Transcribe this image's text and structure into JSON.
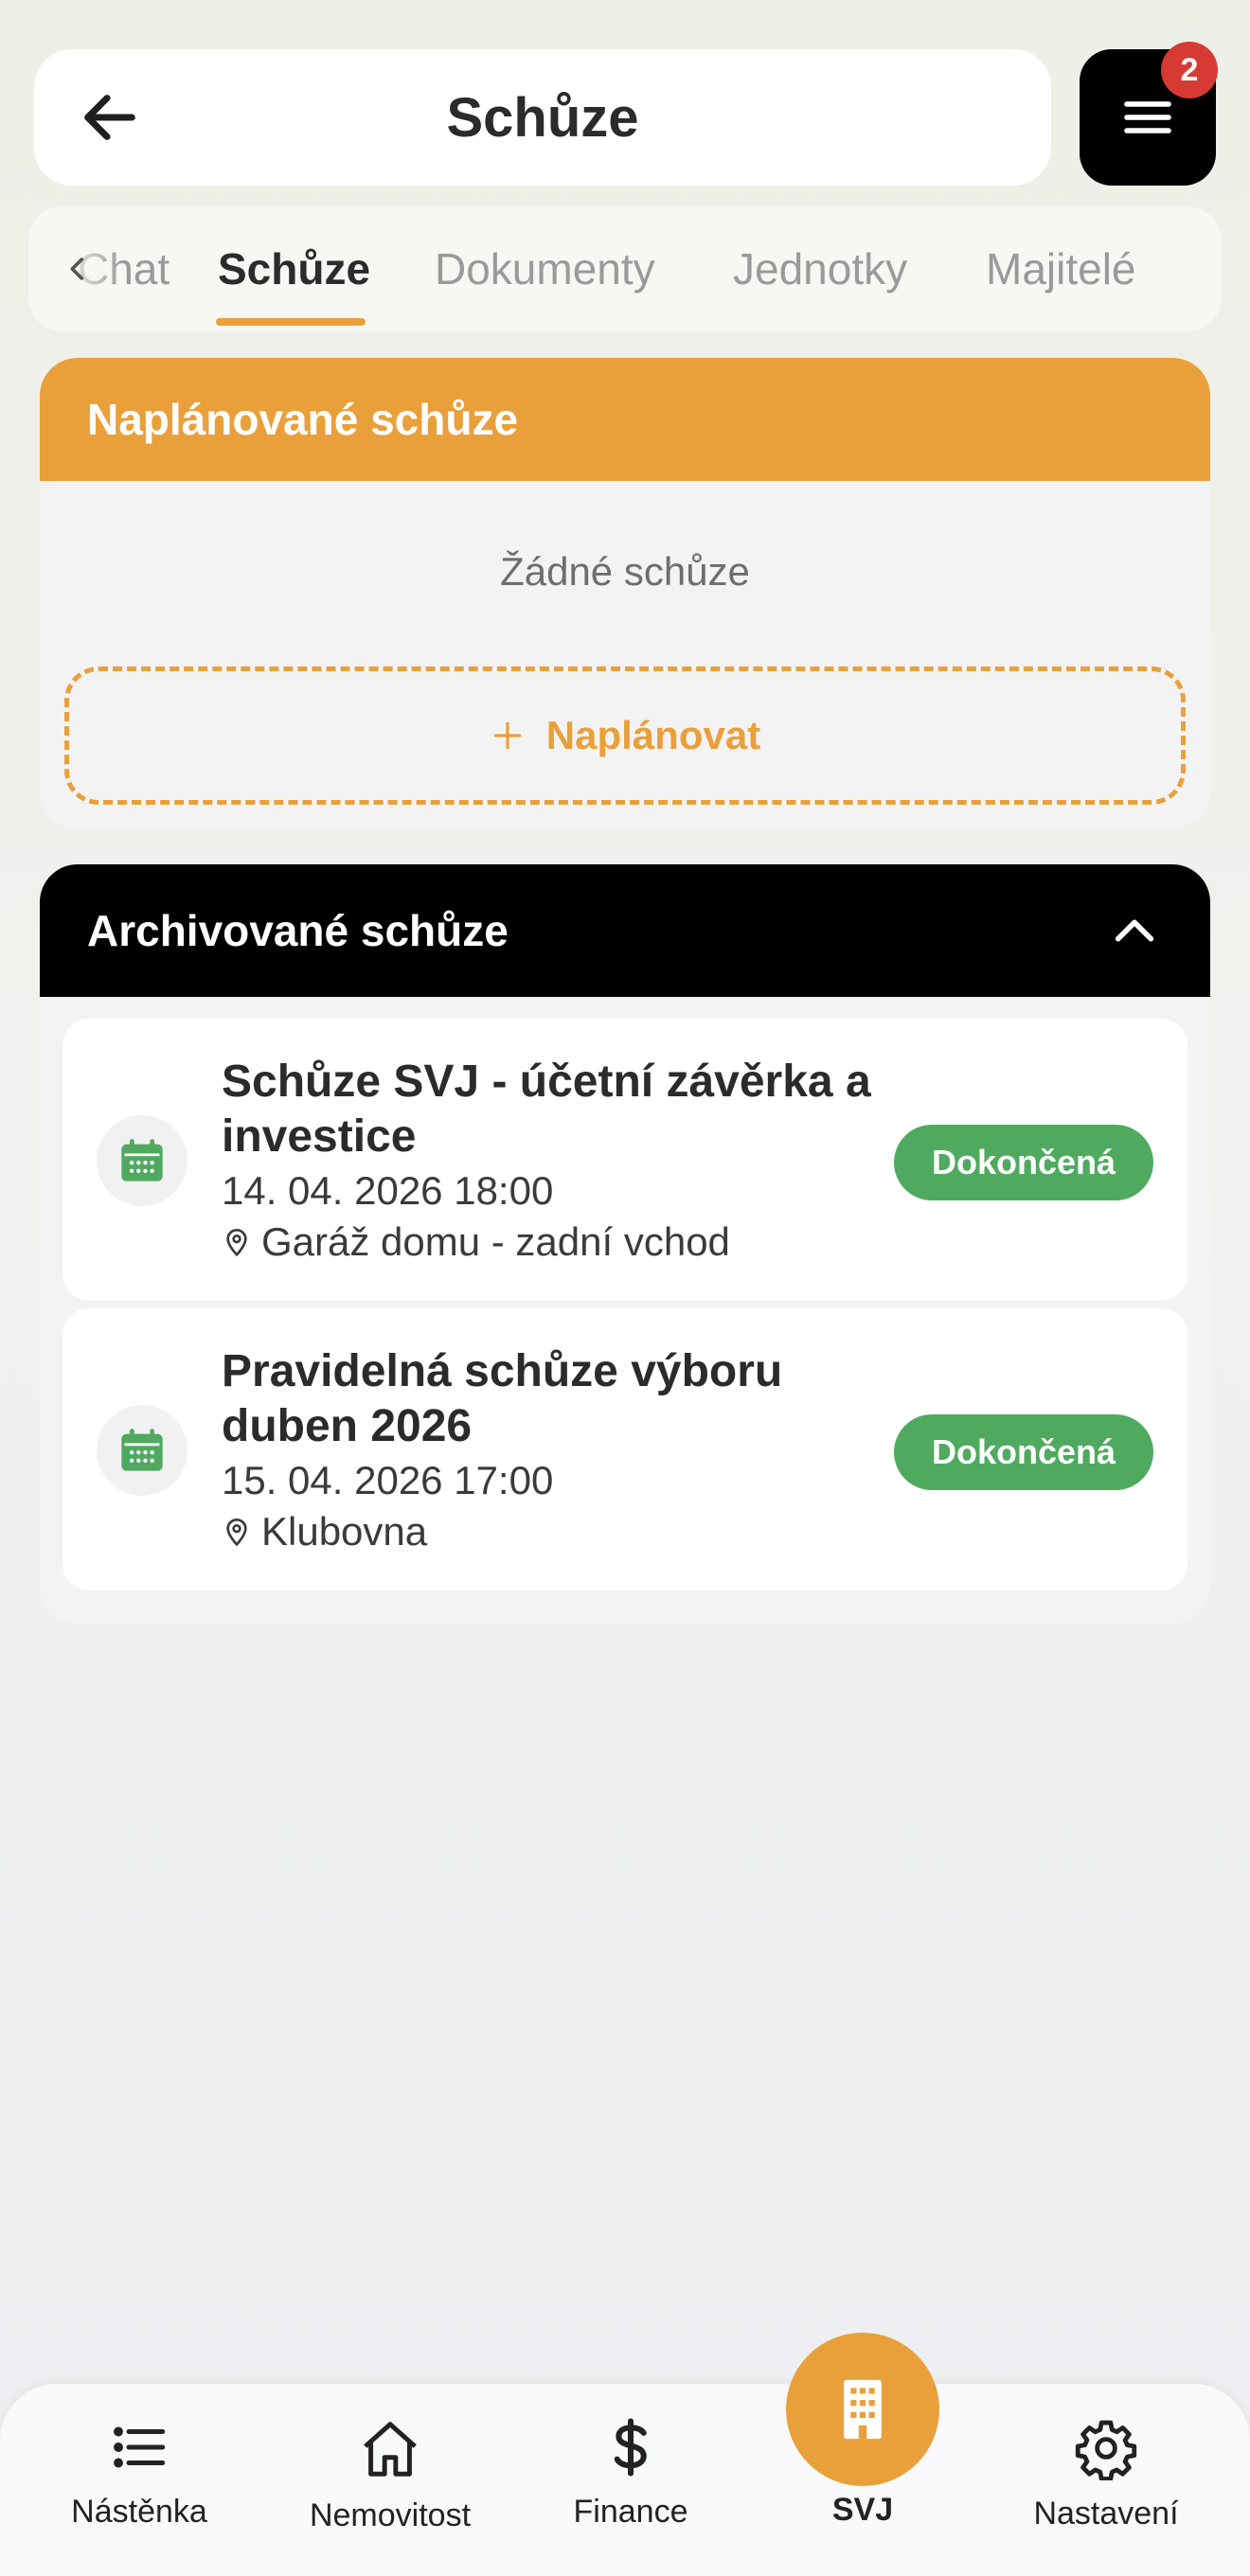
{
  "header": {
    "title": "Schůze",
    "menu_badge": "2",
    "icons": {
      "back": "arrow-left-icon",
      "menu": "hamburger-icon"
    }
  },
  "tabs": [
    {
      "label": "Chat",
      "active": false
    },
    {
      "label": "Schůze",
      "active": true
    },
    {
      "label": "Dokumenty",
      "active": false
    },
    {
      "label": "Jednotky",
      "active": false
    },
    {
      "label": "Majitelé",
      "active": false
    }
  ],
  "planned": {
    "title": "Naplánované schůze",
    "empty_text": "Žádné schůze",
    "plan_button": "Naplánovat"
  },
  "archived": {
    "title": "Archivované schůze",
    "meetings": [
      {
        "title": "Schůze SVJ - účetní závěrka a investice",
        "date": "14. 04. 2026 18:00",
        "place": "Garáž domu - zadní vchod",
        "status": "Dokončená"
      },
      {
        "title": "Pravidelná schůze výboru duben 2026",
        "date": "15. 04. 2026 17:00",
        "place": "Klubovna",
        "status": "Dokončená"
      }
    ]
  },
  "bottom_nav": [
    {
      "label": "Nástěnka",
      "icon": "list-icon"
    },
    {
      "label": "Nemovitost",
      "icon": "house-icon"
    },
    {
      "label": "Finance",
      "icon": "dollar-icon"
    },
    {
      "label": "SVJ",
      "icon": "building-icon",
      "active": true
    },
    {
      "label": "Nastavení",
      "icon": "gear-icon"
    }
  ],
  "colors": {
    "accent": "#e9a03b",
    "success": "#4faa60",
    "dark": "#000000",
    "badge": "#d63a33"
  }
}
